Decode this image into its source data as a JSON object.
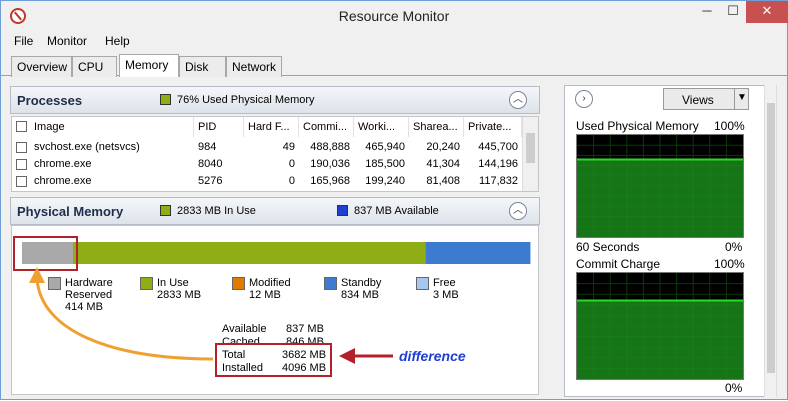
{
  "window": {
    "title": "Resource Monitor",
    "min": "─",
    "max": "☐",
    "close": "✕"
  },
  "menu": [
    "File",
    "Monitor",
    "Help"
  ],
  "tabs": [
    "Overview",
    "CPU",
    "Memory",
    "Disk",
    "Network"
  ],
  "processes": {
    "title": "Processes",
    "badge": "76% Used Physical Memory",
    "columns": [
      "Image",
      "PID",
      "Hard F...",
      "Commi...",
      "Worki...",
      "Sharea...",
      "Private..."
    ],
    "rows": [
      [
        "svchost.exe (netsvcs)",
        "984",
        "49",
        "488,888",
        "465,940",
        "20,240",
        "445,700"
      ],
      [
        "chrome.exe",
        "8040",
        "0",
        "190,036",
        "185,500",
        "41,304",
        "144,196"
      ],
      [
        "chrome.exe",
        "5276",
        "0",
        "165,968",
        "199,240",
        "81,408",
        "117,832"
      ]
    ]
  },
  "physical": {
    "title": "Physical Memory",
    "in_use_badge": "2833 MB In Use",
    "available_badge": "837 MB Available",
    "bar": [
      {
        "name": "Hardware Reserved",
        "mb": 414,
        "color": "#a9a9a9"
      },
      {
        "name": "In Use",
        "mb": 2833,
        "color": "#8fad15"
      },
      {
        "name": "Modified",
        "mb": 12,
        "color": "#e07b00"
      },
      {
        "name": "Standby",
        "mb": 834,
        "color": "#3d7bd1"
      },
      {
        "name": "Free",
        "mb": 3,
        "color": "#a6c8f0"
      }
    ],
    "legend": [
      {
        "l1": "Hardware",
        "l2": "Reserved",
        "l3": "414 MB"
      },
      {
        "l1": "In Use",
        "l2": "2833 MB",
        "l3": ""
      },
      {
        "l1": "Modified",
        "l2": "12 MB",
        "l3": ""
      },
      {
        "l1": "Standby",
        "l2": "834 MB",
        "l3": ""
      },
      {
        "l1": "Free",
        "l2": "3 MB",
        "l3": ""
      }
    ],
    "stats": [
      {
        "label": "Available",
        "value": "837 MB"
      },
      {
        "label": "Cached",
        "value": "846 MB"
      },
      {
        "label": "Total",
        "value": "3682 MB"
      },
      {
        "label": "Installed",
        "value": "4096 MB"
      }
    ]
  },
  "annotation": {
    "label": "difference"
  },
  "right": {
    "views_label": "Views",
    "graph1": {
      "title": "Used Physical Memory",
      "max": "100%",
      "time": "60 Seconds",
      "min": "0%",
      "level": 0.76
    },
    "graph2": {
      "title": "Commit Charge",
      "max": "100%",
      "time": "",
      "min": "0%",
      "level": 0.74
    }
  },
  "colors": {
    "in_use": "#8fad15",
    "available": "#1f3fd1",
    "annotation": "#b3202a",
    "arrow": "#f0a030",
    "graph_line": "#22dd22"
  }
}
